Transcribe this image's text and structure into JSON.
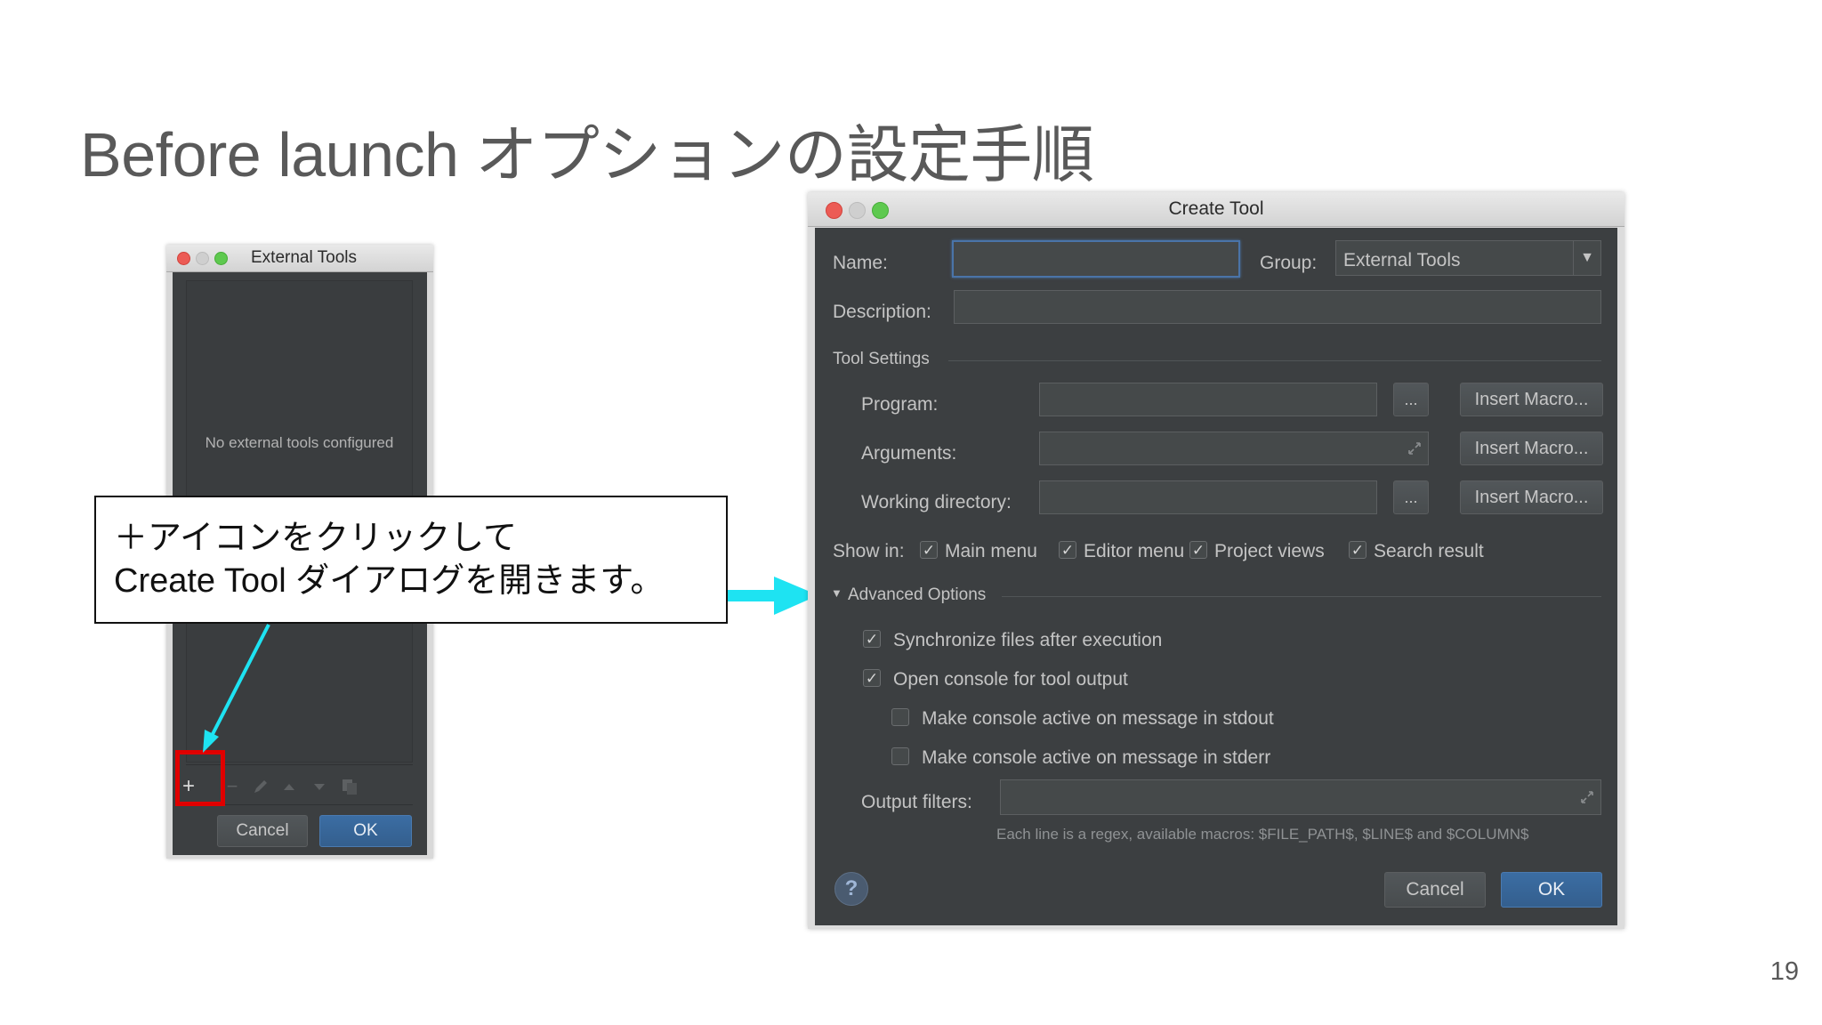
{
  "slide": {
    "title": "Before launch オプションの設定手順",
    "page_number": "19"
  },
  "colors": {
    "dialog_bg": "#3c3f41",
    "accent_blue": "#365880",
    "highlight_red": "#e00000",
    "arrow_cyan": "#1ee3f2"
  },
  "external_tools": {
    "window_title": "External Tools",
    "empty_text": "No external tools configured",
    "toolbar": {
      "add": "+",
      "remove": "−",
      "edit_icon": "pencil-icon",
      "up_icon": "arrow-up-icon",
      "down_icon": "arrow-down-icon",
      "copy_icon": "copy-icon"
    },
    "cancel_label": "Cancel",
    "ok_label": "OK"
  },
  "callout": {
    "line1": "＋アイコンをクリックして",
    "line2": "Create Tool ダイアログを開きます。"
  },
  "create_tool": {
    "window_title": "Create Tool",
    "name_label": "Name:",
    "name_value": "",
    "group_label": "Group:",
    "group_value": "External Tools",
    "description_label": "Description:",
    "description_value": "",
    "tool_settings_label": "Tool Settings",
    "program_label": "Program:",
    "arguments_label": "Arguments:",
    "working_dir_label": "Working directory:",
    "browse_label": "...",
    "insert_macro_label": "Insert Macro...",
    "show_in_label": "Show in:",
    "show_in": [
      {
        "label": "Main menu",
        "checked": true
      },
      {
        "label": "Editor menu",
        "checked": true
      },
      {
        "label": "Project views",
        "checked": true
      },
      {
        "label": "Search result",
        "checked": true
      }
    ],
    "advanced_label": "Advanced Options",
    "sync_files_label": "Synchronize files after execution",
    "open_console_label": "Open console for tool output",
    "stdout_label": "Make console active on message in stdout",
    "stderr_label": "Make console active on message in stderr",
    "output_filters_label": "Output filters:",
    "hint": "Each line is a regex, available macros: $FILE_PATH$, $LINE$ and $COLUMN$",
    "help_label": "?",
    "cancel_label": "Cancel",
    "ok_label": "OK"
  }
}
